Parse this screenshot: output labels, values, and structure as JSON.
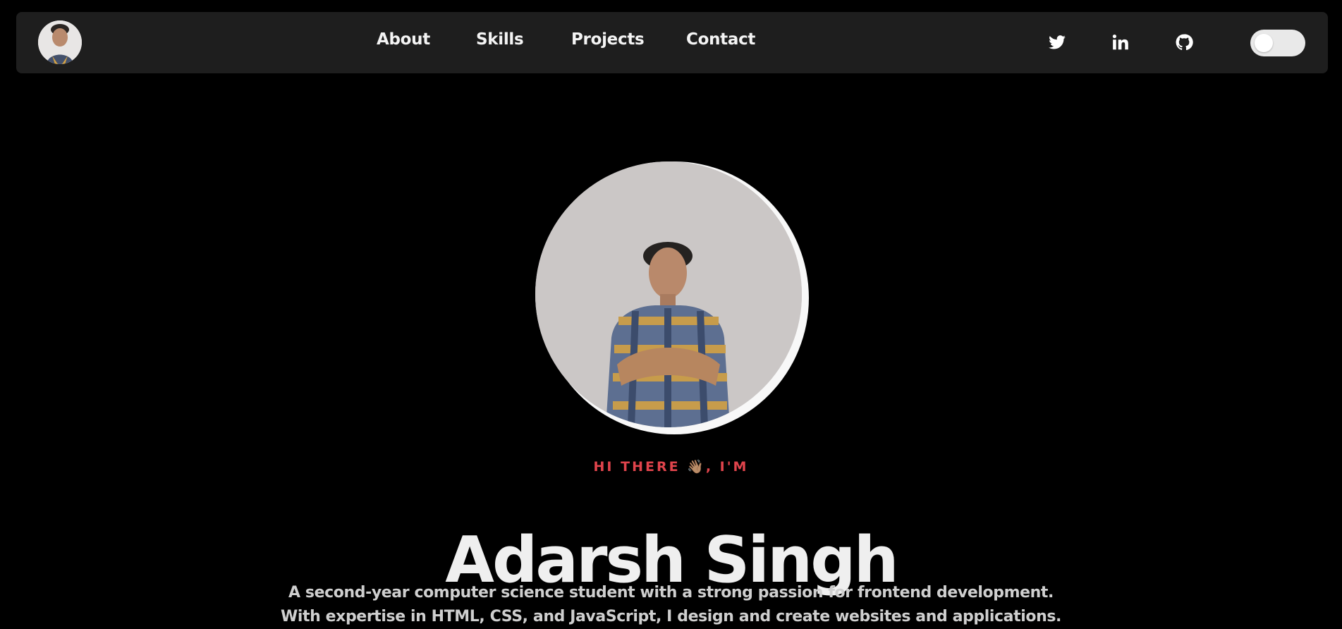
{
  "nav": {
    "links": [
      {
        "label": "About"
      },
      {
        "label": "Skills"
      },
      {
        "label": "Projects"
      },
      {
        "label": "Contact"
      }
    ],
    "social_icons": [
      "twitter-icon",
      "linkedin-icon",
      "github-icon"
    ],
    "theme_toggle": {
      "state": "off"
    }
  },
  "hero": {
    "greeting": "HI THERE 👋🏽, I'M",
    "name": "Adarsh Singh",
    "description_line1": "A second-year computer science student with a strong passion for frontend development.",
    "description_line2": "With expertise in HTML, CSS, and JavaScript, I design and create websites and applications."
  },
  "colors": {
    "background": "#000000",
    "navbar": "#1e1e1e",
    "accent": "#e0444c",
    "heading": "#efefef",
    "body_text": "#cfcfcf"
  }
}
